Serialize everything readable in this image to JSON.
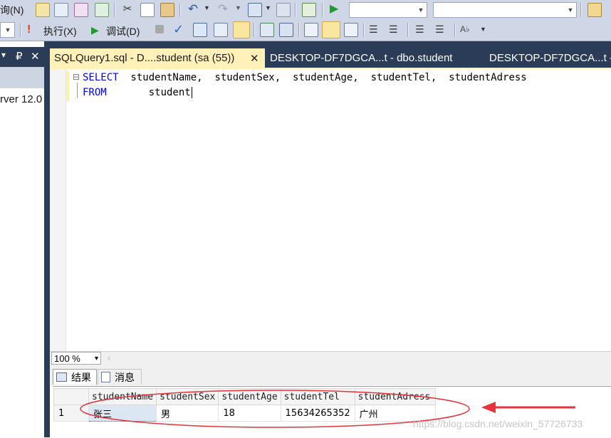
{
  "toolbar1": {
    "query_menu_fragment": "询(N)"
  },
  "toolbar2": {
    "execute_label": "执行(X)",
    "debug_label": "调试(D)"
  },
  "left_panel": {
    "server_text": "rver 12.0",
    "pin_glyph": "₽",
    "close_glyph": "✕",
    "dropdown_glyph": "▾"
  },
  "tabs": [
    {
      "label": "SQLQuery1.sql - D....student (sa (55))",
      "active": true,
      "close_glyph": "✕"
    },
    {
      "label": "DESKTOP-DF7DGCA...t - dbo.student",
      "active": false
    },
    {
      "label": "DESKTOP-DF7DGCA...t - ",
      "active": false
    }
  ],
  "editor": {
    "line1_keyword": "SELECT",
    "line1_rest": "  studentName,  studentSex,  studentAge,  studentTel,  studentAdress",
    "line2_keyword": "FROM",
    "line2_rest": "       student",
    "fold_glyph": "⊟",
    "keyword_color": "#0000ff"
  },
  "zoom": {
    "value": "100 %",
    "arrow": "▾",
    "scroll_arrow": "‹"
  },
  "result_tabs": [
    {
      "label": "结果",
      "active": true
    },
    {
      "label": "消息",
      "active": false
    }
  ],
  "grid": {
    "columns": [
      "studentName",
      "studentSex",
      "studentAge",
      "studentTel",
      "studentAdress"
    ],
    "rows": [
      {
        "row_number": "1",
        "cells": [
          "张三",
          "男",
          "18",
          "15634265352",
          "广州"
        ]
      }
    ]
  },
  "annotation": {
    "ellipse_color": "#e8323c",
    "arrow_color": "#e8323c"
  },
  "watermark": "https://blog.csdn.net/weixin_57726733"
}
